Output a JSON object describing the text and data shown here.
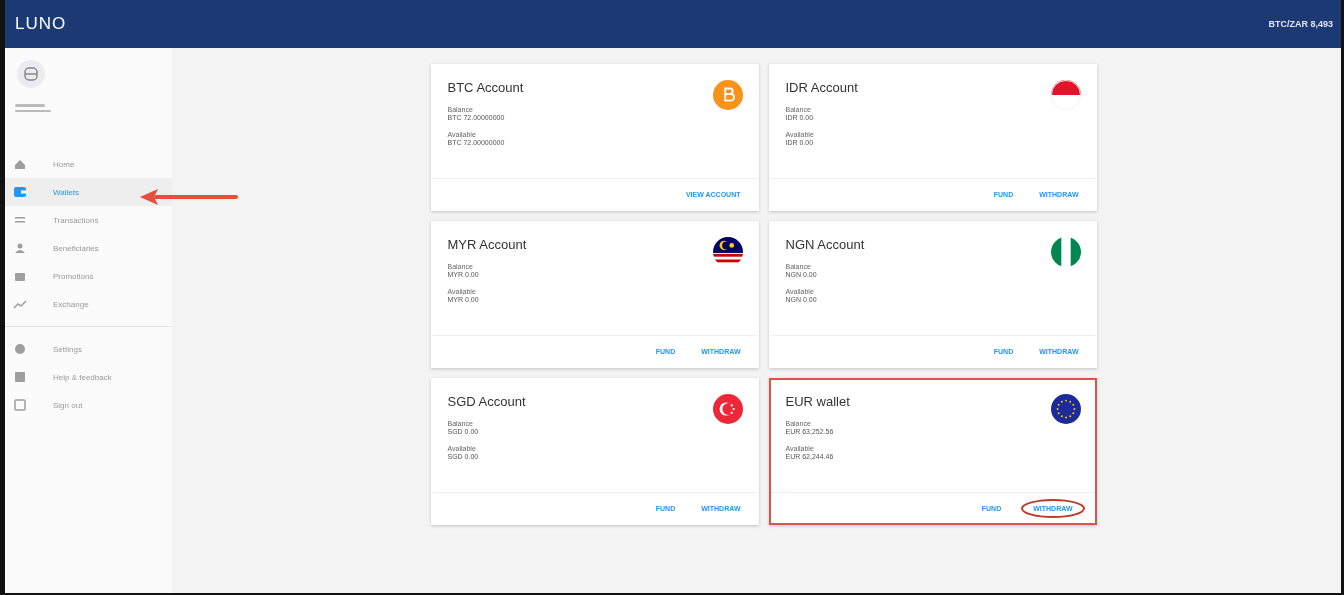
{
  "header": {
    "logo": "LUNO",
    "ticker": "BTC/ZAR 8,493"
  },
  "sidebar": {
    "items": [
      {
        "label": "Home",
        "kind": "home",
        "selected": false
      },
      {
        "label": "Wallets",
        "kind": "wallet",
        "selected": true
      },
      {
        "label": "Transactions",
        "kind": "list",
        "selected": false
      },
      {
        "label": "Beneficiaries",
        "kind": "people",
        "selected": false
      },
      {
        "label": "Promotions",
        "kind": "gift",
        "selected": false
      },
      {
        "label": "Exchange",
        "kind": "chart",
        "selected": false
      }
    ],
    "footer_items": [
      {
        "label": "Settings",
        "kind": "gear",
        "selected": false
      },
      {
        "label": "Help & feedback",
        "kind": "help",
        "selected": false
      },
      {
        "label": "Sign out",
        "kind": "exit",
        "selected": false
      }
    ]
  },
  "accounts": [
    {
      "title": "BTC Account",
      "kind": "btc",
      "highlighted": false,
      "balance_label": "Balance",
      "balance": "BTC 72.00000000",
      "available_label": "Available",
      "available": "BTC 72.00000000",
      "actions": [
        {
          "label": "VIEW ACCOUNT",
          "circled": false
        }
      ]
    },
    {
      "title": "IDR Account",
      "kind": "idr",
      "highlighted": false,
      "balance_label": "Balance",
      "balance": "IDR 0.00",
      "available_label": "Available",
      "available": "IDR 0.00",
      "actions": [
        {
          "label": "FUND",
          "circled": false
        },
        {
          "label": "WITHDRAW",
          "circled": false
        }
      ]
    },
    {
      "title": "MYR Account",
      "kind": "myr",
      "highlighted": false,
      "balance_label": "Balance",
      "balance": "MYR 0.00",
      "available_label": "Available",
      "available": "MYR 0.00",
      "actions": [
        {
          "label": "FUND",
          "circled": false
        },
        {
          "label": "WITHDRAW",
          "circled": false
        }
      ]
    },
    {
      "title": "NGN Account",
      "kind": "ngn",
      "highlighted": false,
      "balance_label": "Balance",
      "balance": "NGN 0.00",
      "available_label": "Available",
      "available": "NGN 0.00",
      "actions": [
        {
          "label": "FUND",
          "circled": false
        },
        {
          "label": "WITHDRAW",
          "circled": false
        }
      ]
    },
    {
      "title": "SGD Account",
      "kind": "sgd",
      "highlighted": false,
      "balance_label": "Balance",
      "balance": "SGD 0.00",
      "available_label": "Available",
      "available": "SGD 0.00",
      "actions": [
        {
          "label": "FUND",
          "circled": false
        },
        {
          "label": "WITHDRAW",
          "circled": false
        }
      ]
    },
    {
      "title": "EUR wallet",
      "kind": "eur",
      "highlighted": true,
      "balance_label": "Balance",
      "balance": "EUR 63,252.56",
      "available_label": "Available",
      "available": "EUR 62,244.46",
      "actions": [
        {
          "label": "FUND",
          "circled": false
        },
        {
          "label": "WITHDRAW",
          "circled": true
        }
      ]
    }
  ]
}
